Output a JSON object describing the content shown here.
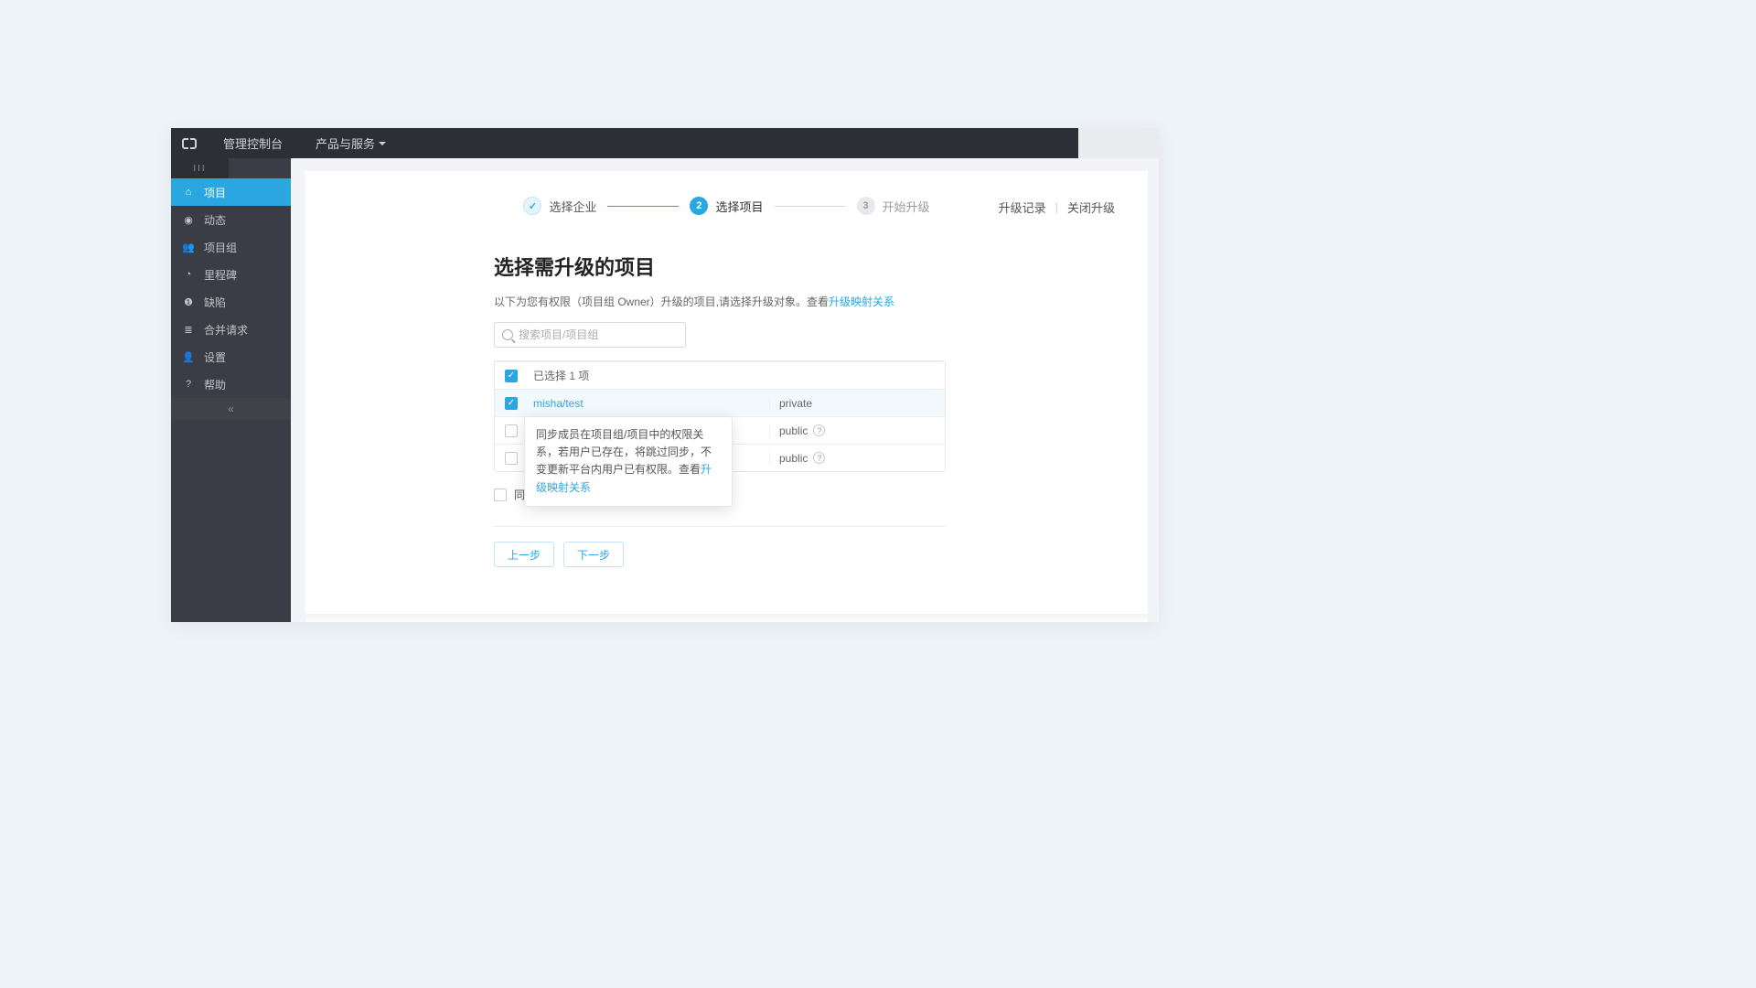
{
  "header": {
    "console_label": "管理控制台",
    "products_label": "产品与服务"
  },
  "sidebar": {
    "stripe": "III",
    "items": [
      {
        "icon": "home-icon",
        "glyph": "⌂",
        "label": "项目",
        "active": true
      },
      {
        "icon": "dash-icon",
        "glyph": "◉",
        "label": "动态",
        "active": false
      },
      {
        "icon": "group-icon",
        "glyph": "👥",
        "label": "项目组",
        "active": false
      },
      {
        "icon": "clock-icon",
        "glyph": "◔",
        "label": "里程碑",
        "active": false
      },
      {
        "icon": "alert-icon",
        "glyph": "❶",
        "label": "缺陷",
        "active": false
      },
      {
        "icon": "merge-icon",
        "glyph": "≣",
        "label": "合并请求",
        "active": false
      },
      {
        "icon": "user-icon",
        "glyph": "👤",
        "label": "设置",
        "active": false
      },
      {
        "icon": "help-icon",
        "glyph": "?",
        "label": "帮助",
        "active": false
      }
    ],
    "collapse_glyph": "«"
  },
  "top_links": {
    "history": "升级记录",
    "close": "关闭升级"
  },
  "steps": [
    {
      "label": "选择企业",
      "state": "done",
      "num": "✓"
    },
    {
      "label": "选择项目",
      "state": "active",
      "num": "2"
    },
    {
      "label": "开始升级",
      "state": "pending",
      "num": "3"
    }
  ],
  "section": {
    "title": "选择需升级的项目",
    "desc_prefix": "以下为您有权限（项目组 Owner）升级的项目,请选择升级对象。查看",
    "desc_link": "升级映射关系"
  },
  "search": {
    "placeholder": "搜索项目/项目组"
  },
  "table": {
    "header_label": "已选择 1 项",
    "rows": [
      {
        "name": "misha/test",
        "visibility": "private",
        "checked": true,
        "help": false,
        "link": true
      },
      {
        "name": "",
        "visibility": "public",
        "checked": false,
        "help": true,
        "link": false
      },
      {
        "name": "",
        "visibility": "public",
        "checked": false,
        "help": true,
        "link": false
      }
    ]
  },
  "tooltip": {
    "text_prefix": "同步成员在项目组/项目中的权限关系，若用户已存在，将跳过同步，不变更新平台内用户已有权限。查看",
    "link": "升级映射关系"
  },
  "sync": {
    "label": "同步项目组及项目的成员"
  },
  "buttons": {
    "prev": "上一步",
    "next": "下一步"
  }
}
